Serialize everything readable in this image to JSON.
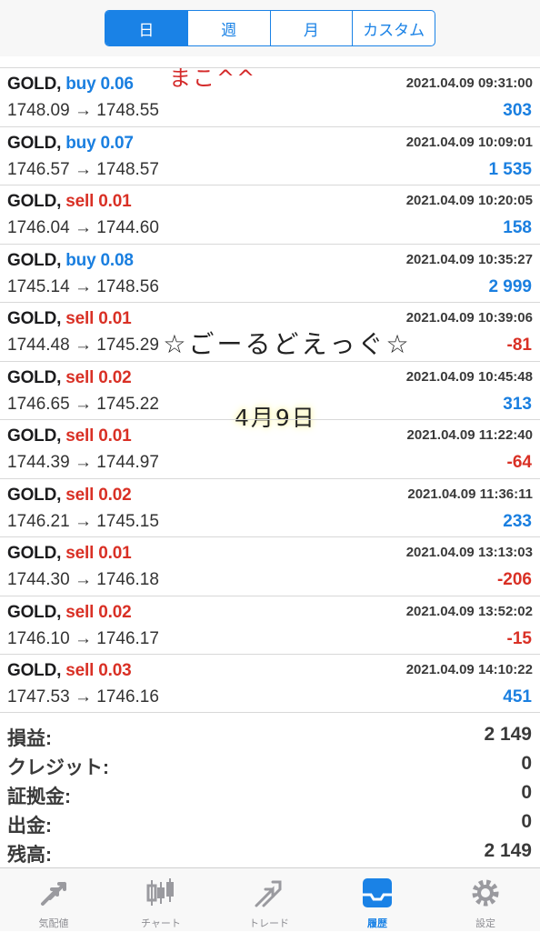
{
  "tabs": [
    "日",
    "週",
    "月",
    "カスタム"
  ],
  "active_tab": 0,
  "trades": [
    {
      "symbol": "GOLD,",
      "side": "buy",
      "volume": "0.06",
      "datetime": "2021.04.09 09:31:00",
      "open": "1748.09",
      "close": "1748.55",
      "profit": "303"
    },
    {
      "symbol": "GOLD,",
      "side": "buy",
      "volume": "0.07",
      "datetime": "2021.04.09 10:09:01",
      "open": "1746.57",
      "close": "1748.57",
      "profit": "1 535"
    },
    {
      "symbol": "GOLD,",
      "side": "sell",
      "volume": "0.01",
      "datetime": "2021.04.09 10:20:05",
      "open": "1746.04",
      "close": "1744.60",
      "profit": "158"
    },
    {
      "symbol": "GOLD,",
      "side": "buy",
      "volume": "0.08",
      "datetime": "2021.04.09 10:35:27",
      "open": "1745.14",
      "close": "1748.56",
      "profit": "2 999"
    },
    {
      "symbol": "GOLD,",
      "side": "sell",
      "volume": "0.01",
      "datetime": "2021.04.09 10:39:06",
      "open": "1744.48",
      "close": "1745.29",
      "profit": "-81"
    },
    {
      "symbol": "GOLD,",
      "side": "sell",
      "volume": "0.02",
      "datetime": "2021.04.09 10:45:48",
      "open": "1746.65",
      "close": "1745.22",
      "profit": "313"
    },
    {
      "symbol": "GOLD,",
      "side": "sell",
      "volume": "0.01",
      "datetime": "2021.04.09 11:22:40",
      "open": "1744.39",
      "close": "1744.97",
      "profit": "-64"
    },
    {
      "symbol": "GOLD,",
      "side": "sell",
      "volume": "0.02",
      "datetime": "2021.04.09 11:36:11",
      "open": "1746.21",
      "close": "1745.15",
      "profit": "233"
    },
    {
      "symbol": "GOLD,",
      "side": "sell",
      "volume": "0.01",
      "datetime": "2021.04.09 13:13:03",
      "open": "1744.30",
      "close": "1746.18",
      "profit": "-206"
    },
    {
      "symbol": "GOLD,",
      "side": "sell",
      "volume": "0.02",
      "datetime": "2021.04.09 13:52:02",
      "open": "1746.10",
      "close": "1746.17",
      "profit": "-15"
    },
    {
      "symbol": "GOLD,",
      "side": "sell",
      "volume": "0.03",
      "datetime": "2021.04.09 14:10:22",
      "open": "1747.53",
      "close": "1746.16",
      "profit": "451"
    }
  ],
  "summary": [
    {
      "label": "損益:",
      "value": "2 149"
    },
    {
      "label": "クレジット:",
      "value": "0"
    },
    {
      "label": "証拠金:",
      "value": "0"
    },
    {
      "label": "出金:",
      "value": "0"
    },
    {
      "label": "残高:",
      "value": "2 149"
    }
  ],
  "tabbar": [
    {
      "label": "気配値",
      "icon": "quotes-icon"
    },
    {
      "label": "チャート",
      "icon": "chart-icon"
    },
    {
      "label": "トレード",
      "icon": "trade-icon"
    },
    {
      "label": "履歴",
      "icon": "history-icon"
    },
    {
      "label": "設定",
      "icon": "settings-icon"
    }
  ],
  "active_bottom_tab": 3,
  "overlays": {
    "name": "まこ^^",
    "title": "☆ごーるどえっぐ☆",
    "date": "4月9日"
  },
  "colors": {
    "accent": "#1a82e6",
    "positive": "#1a7fe0",
    "negative": "#d93025"
  }
}
